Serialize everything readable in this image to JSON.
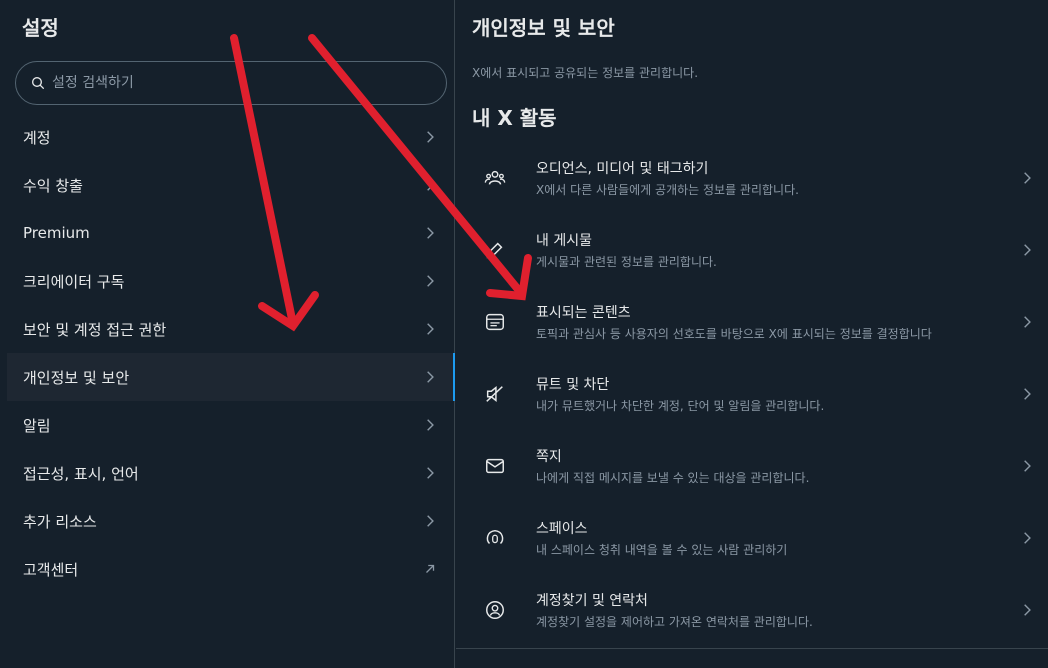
{
  "left": {
    "title": "설정",
    "search_placeholder": "설정 검색하기",
    "items": [
      {
        "label": "계정",
        "icon": "chevron-right-icon"
      },
      {
        "label": "수익 창출",
        "icon": "chevron-right-icon"
      },
      {
        "label": "Premium",
        "icon": "chevron-right-icon"
      },
      {
        "label": "크리에이터 구독",
        "icon": "chevron-right-icon"
      },
      {
        "label": "보안 및 계정 접근 권한",
        "icon": "chevron-right-icon"
      },
      {
        "label": "개인정보 및 보안",
        "icon": "chevron-right-icon",
        "active": true
      },
      {
        "label": "알림",
        "icon": "chevron-right-icon"
      },
      {
        "label": "접근성, 표시, 언어",
        "icon": "chevron-right-icon"
      },
      {
        "label": "추가 리소스",
        "icon": "chevron-right-icon"
      },
      {
        "label": "고객센터",
        "icon": "external-arrow-icon"
      }
    ]
  },
  "right": {
    "title": "개인정보 및 보안",
    "description": "X에서 표시되고 공유되는 정보를 관리합니다.",
    "section": "내 X 활동",
    "items": [
      {
        "label": "오디언스, 미디어 및 태그하기",
        "sub": "X에서 다른 사람들에게 공개하는 정보를 관리합니다.",
        "icon": "people-icon"
      },
      {
        "label": "내 게시물",
        "sub": "게시물과 관련된 정보를 관리합니다.",
        "icon": "pencil-icon"
      },
      {
        "label": "표시되는 콘텐츠",
        "sub": "토픽과 관심사 등 사용자의 선호도를 바탕으로 X에 표시되는 정보를 결정합니다",
        "icon": "content-icon"
      },
      {
        "label": "뮤트 및 차단",
        "sub": "내가 뮤트했거나 차단한 계정, 단어 및 알림을 관리합니다.",
        "icon": "mute-icon"
      },
      {
        "label": "쪽지",
        "sub": "나에게 직접 메시지를 보낼 수 있는 대상을 관리합니다.",
        "icon": "envelope-icon"
      },
      {
        "label": "스페이스",
        "sub": "내 스페이스 청취 내역을 볼 수 있는 사람 관리하기",
        "icon": "spaces-icon"
      },
      {
        "label": "계정찾기 및 연락처",
        "sub": "계정찾기 설정을 제어하고 가져온 연락처를 관리합니다.",
        "icon": "contacts-icon"
      }
    ]
  },
  "colors": {
    "background": "#15202b",
    "active_row": "#1e2732",
    "accent": "#1d9bf0",
    "annotation_arrow": "#e0202e"
  }
}
